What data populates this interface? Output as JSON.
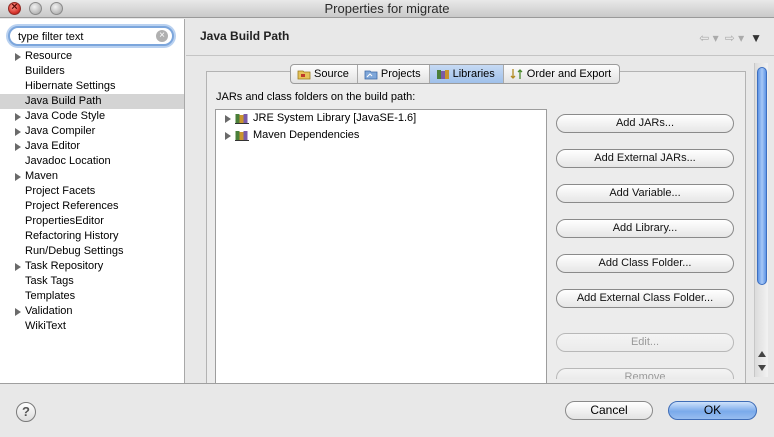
{
  "window": {
    "title": "Properties for migrate"
  },
  "filter": {
    "value": "type filter text"
  },
  "sidebar": {
    "items": [
      {
        "label": "Resource",
        "expandable": true
      },
      {
        "label": "Builders",
        "expandable": false
      },
      {
        "label": "Hibernate Settings",
        "expandable": false
      },
      {
        "label": "Java Build Path",
        "expandable": false,
        "selected": true
      },
      {
        "label": "Java Code Style",
        "expandable": true
      },
      {
        "label": "Java Compiler",
        "expandable": true
      },
      {
        "label": "Java Editor",
        "expandable": true
      },
      {
        "label": "Javadoc Location",
        "expandable": false
      },
      {
        "label": "Maven",
        "expandable": true
      },
      {
        "label": "Project Facets",
        "expandable": false
      },
      {
        "label": "Project References",
        "expandable": false
      },
      {
        "label": "PropertiesEditor",
        "expandable": false
      },
      {
        "label": "Refactoring History",
        "expandable": false
      },
      {
        "label": "Run/Debug Settings",
        "expandable": false
      },
      {
        "label": "Task Repository",
        "expandable": true
      },
      {
        "label": "Task Tags",
        "expandable": false
      },
      {
        "label": "Templates",
        "expandable": false
      },
      {
        "label": "Validation",
        "expandable": true
      },
      {
        "label": "WikiText",
        "expandable": false
      }
    ]
  },
  "main": {
    "title": "Java Build Path",
    "tabs": [
      {
        "label": "Source",
        "icon": "source-folder-icon"
      },
      {
        "label": "Projects",
        "icon": "projects-icon"
      },
      {
        "label": "Libraries",
        "icon": "libraries-icon",
        "active": true
      },
      {
        "label": "Order and Export",
        "icon": "order-export-icon"
      }
    ],
    "classpath_label": "JARs and class folders on the build path:",
    "libraries": [
      {
        "label": "JRE System Library [JavaSE-1.6]"
      },
      {
        "label": "Maven Dependencies"
      }
    ],
    "buttons": {
      "add_jars": "Add JARs...",
      "add_external_jars": "Add External JARs...",
      "add_variable": "Add Variable...",
      "add_library": "Add Library...",
      "add_class_folder": "Add Class Folder...",
      "add_external_class_folder": "Add External Class Folder...",
      "edit": "Edit...",
      "remove": "Remove"
    }
  },
  "footer": {
    "help": "?",
    "cancel": "Cancel",
    "ok": "OK"
  },
  "colors": {
    "accent": "#7aaaeb",
    "selection": "#d4d4d4"
  }
}
